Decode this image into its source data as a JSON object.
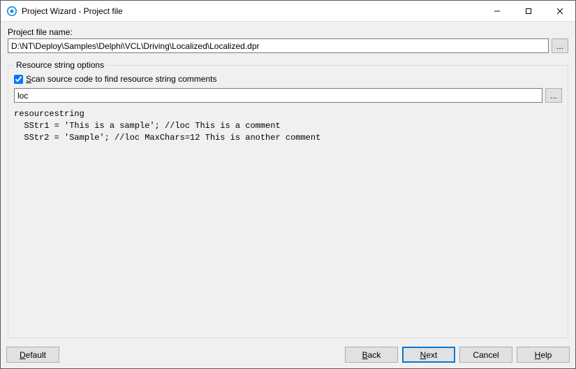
{
  "window": {
    "title": "Project Wizard - Project file"
  },
  "path": {
    "label": "Project file name:",
    "value": "D:\\NT\\Deploy\\Samples\\Delphi\\VCL\\Driving\\Localized\\Localized.dpr",
    "browse": "..."
  },
  "group": {
    "legend": "Resource string options",
    "checkbox_prefix": "S",
    "checkbox_rest": "can source code to find resource string comments",
    "checkbox_checked": true,
    "loc_value": "loc",
    "loc_browse": "...",
    "code": "resourcestring\n  SStr1 = 'This is a sample'; //loc This is a comment\n  SStr2 = 'Sample'; //loc MaxChars=12 This is another comment"
  },
  "buttons": {
    "default_u": "D",
    "default_rest": "efault",
    "back_u": "B",
    "back_rest": "ack",
    "next_u": "N",
    "next_rest": "ext",
    "cancel": "Cancel",
    "help_u": "H",
    "help_rest": "elp"
  }
}
